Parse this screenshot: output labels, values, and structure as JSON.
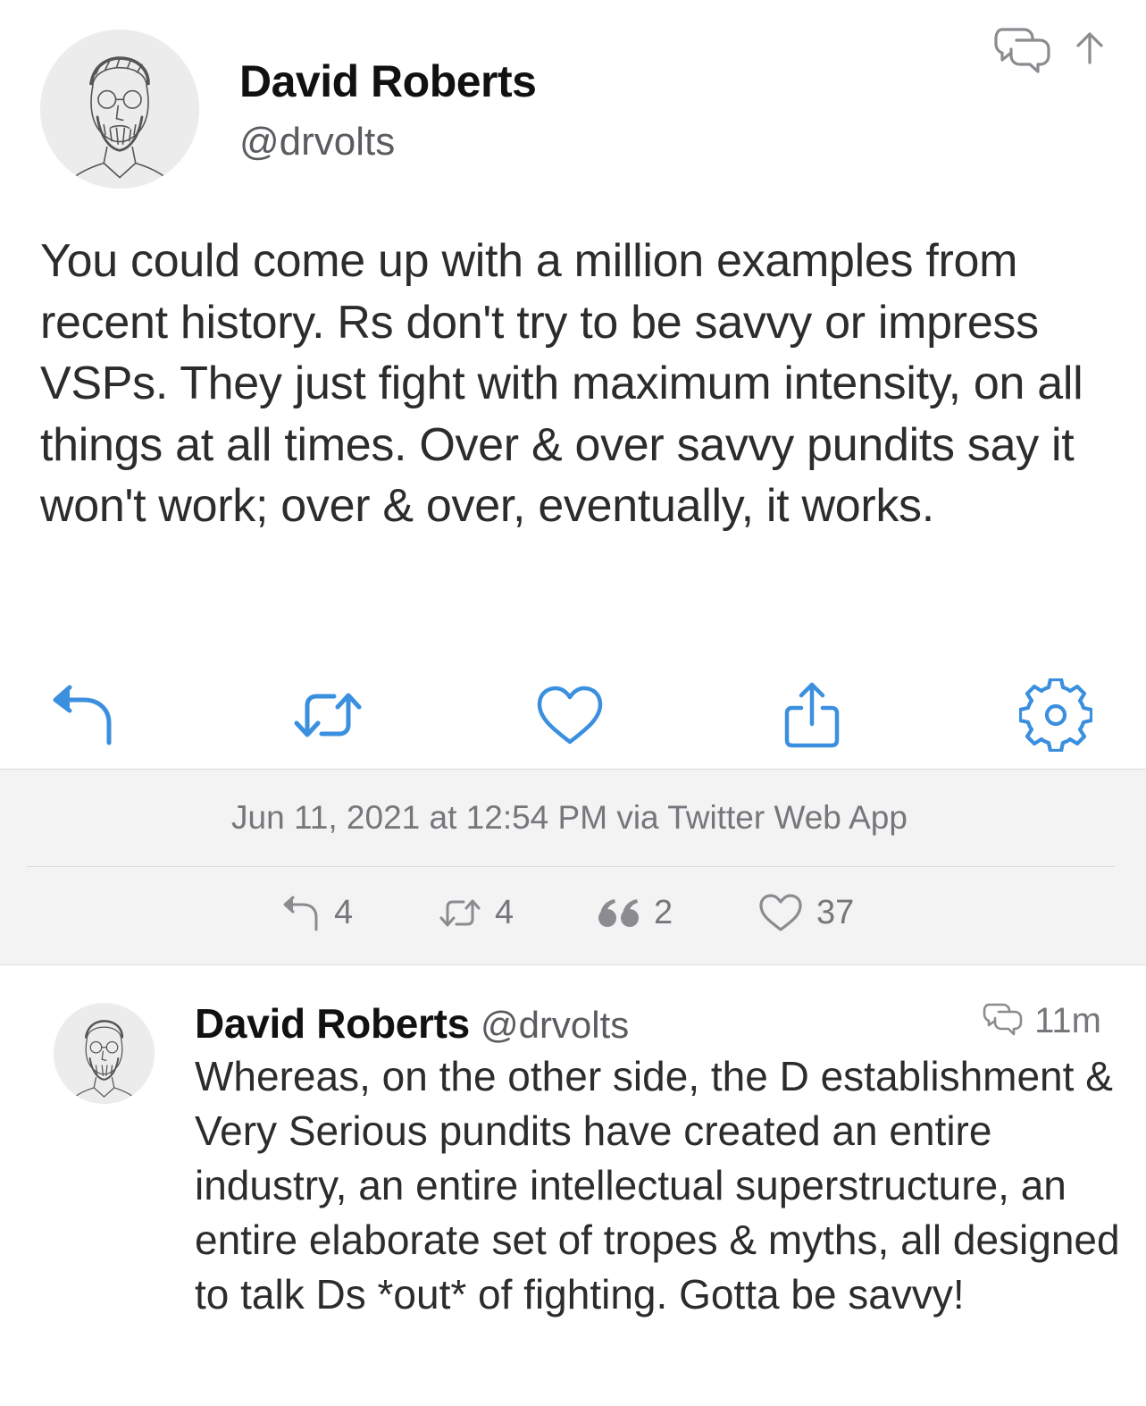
{
  "tweet": {
    "author": {
      "display_name": "David Roberts",
      "handle": "@drvolts"
    },
    "text": "You could come up with a million examples from recent history. Rs don't try to be savvy or impress VSPs. They just fight with maximum intensity, on all things at all times. Over & over savvy pundits say it won't work; over & over, eventually, it works.",
    "header_icons": [
      "conversation-icon",
      "scroll-up-arrow-icon"
    ],
    "actions": [
      {
        "icon": "reply-icon"
      },
      {
        "icon": "retweet-icon"
      },
      {
        "icon": "like-heart-icon"
      },
      {
        "icon": "share-icon"
      },
      {
        "icon": "settings-gear-icon"
      }
    ],
    "timestamp": "Jun 11, 2021 at 12:54 PM via Twitter Web App",
    "stats": {
      "replies": "4",
      "retweets": "4",
      "quotes": "2",
      "likes": "37"
    }
  },
  "reply": {
    "author": {
      "display_name": "David Roberts",
      "handle": "@drvolts"
    },
    "time": "11m",
    "text": "Whereas, on the other side, the D establishment & Very Serious pundits have created an entire industry, an entire intellectual superstructure, an entire elaborate set of tropes & myths, all designed to talk Ds *out* of fighting. Gotta be savvy!"
  },
  "colors": {
    "accent": "#3b8fdf",
    "secondary_text": "#76767b",
    "meta_background": "#f3f3f4"
  }
}
